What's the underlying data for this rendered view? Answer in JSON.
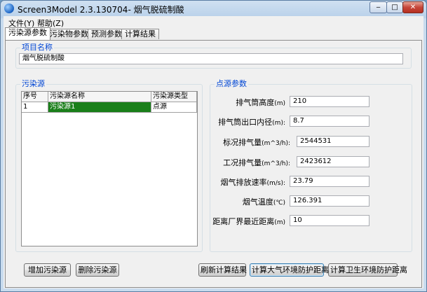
{
  "window": {
    "title": "Screen3Model 2.3.130704- 烟气脱硫制酸",
    "buttons": {
      "minimize": "‒",
      "maximize": "□",
      "close": "✕"
    }
  },
  "menu": [
    {
      "label": "文件(Y)"
    },
    {
      "label": "帮助(Z)"
    }
  ],
  "tabs": [
    {
      "label": "污染源参数",
      "active": true
    },
    {
      "label": "污染物参数",
      "active": false
    },
    {
      "label": "预测参数",
      "active": false
    },
    {
      "label": "计算结果",
      "active": false
    }
  ],
  "project": {
    "group_label": "项目名称",
    "name": "烟气脱硫制酸"
  },
  "sources": {
    "group_label": "污染源",
    "columns": [
      "序号",
      "污染源名称",
      "污染源类型"
    ],
    "rows": [
      {
        "index": "1",
        "name": "污染源1",
        "type": "点源",
        "selected": true
      }
    ]
  },
  "point_params": {
    "group_label": "点源参数",
    "fields": [
      {
        "label": "排气筒高度",
        "unit": "(m)",
        "value": "210"
      },
      {
        "label": "排气筒出口内径",
        "unit": "(m):",
        "value": "8.7"
      },
      {
        "label": "标况排气量",
        "unit": "(m^3/h):",
        "value": "2544531"
      },
      {
        "label": "工况排气量",
        "unit": "(m^3/h):",
        "value": "2423612"
      },
      {
        "label": "烟气排放速率",
        "unit": "(m/s):",
        "value": "23.79"
      },
      {
        "label": "烟气温度",
        "unit": "(℃)",
        "value": "126.391"
      },
      {
        "label": "距离厂界最近距离",
        "unit": "(m)",
        "value": "10"
      }
    ]
  },
  "buttons": {
    "add_source": "增加污染源",
    "delete_source": "删除污染源",
    "refresh_results": "刷新计算结果",
    "calc_air_distance": "计算大气环境防护距离",
    "calc_sanitary_distance": "计算卫生环境防护距离"
  }
}
